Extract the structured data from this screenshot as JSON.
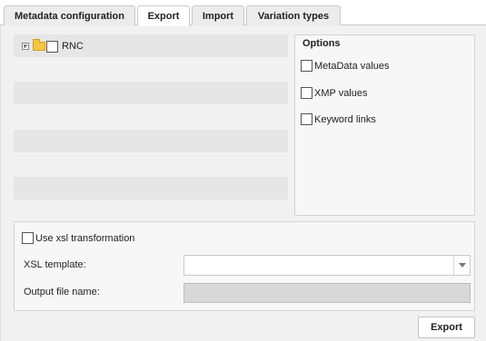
{
  "tabs": [
    {
      "label": "Metadata configuration",
      "active": false
    },
    {
      "label": "Export",
      "active": true
    },
    {
      "label": "Import",
      "active": false
    },
    {
      "label": "Variation types",
      "active": false
    }
  ],
  "tree": {
    "root": {
      "label": "RNC",
      "icon": "folder-icon",
      "expand_icon": "expand-plus-icon",
      "checked": false
    }
  },
  "options": {
    "title": "Options",
    "items": [
      {
        "label": "MetaData values",
        "checked": false
      },
      {
        "label": "XMP values",
        "checked": false
      },
      {
        "label": "Keyword links",
        "checked": false
      }
    ]
  },
  "xsl": {
    "use_label": "Use xsl transformation",
    "use_checked": false,
    "template_label": "XSL template:",
    "template_value": "",
    "output_label": "Output file name:",
    "output_value": ""
  },
  "actions": {
    "export_label": "Export"
  },
  "colors": {
    "panel_bg": "#f1f1f1",
    "stripe_bg": "#e6e6e6",
    "folder": "#f5c543",
    "disabled_input": "#d8d8d8"
  }
}
